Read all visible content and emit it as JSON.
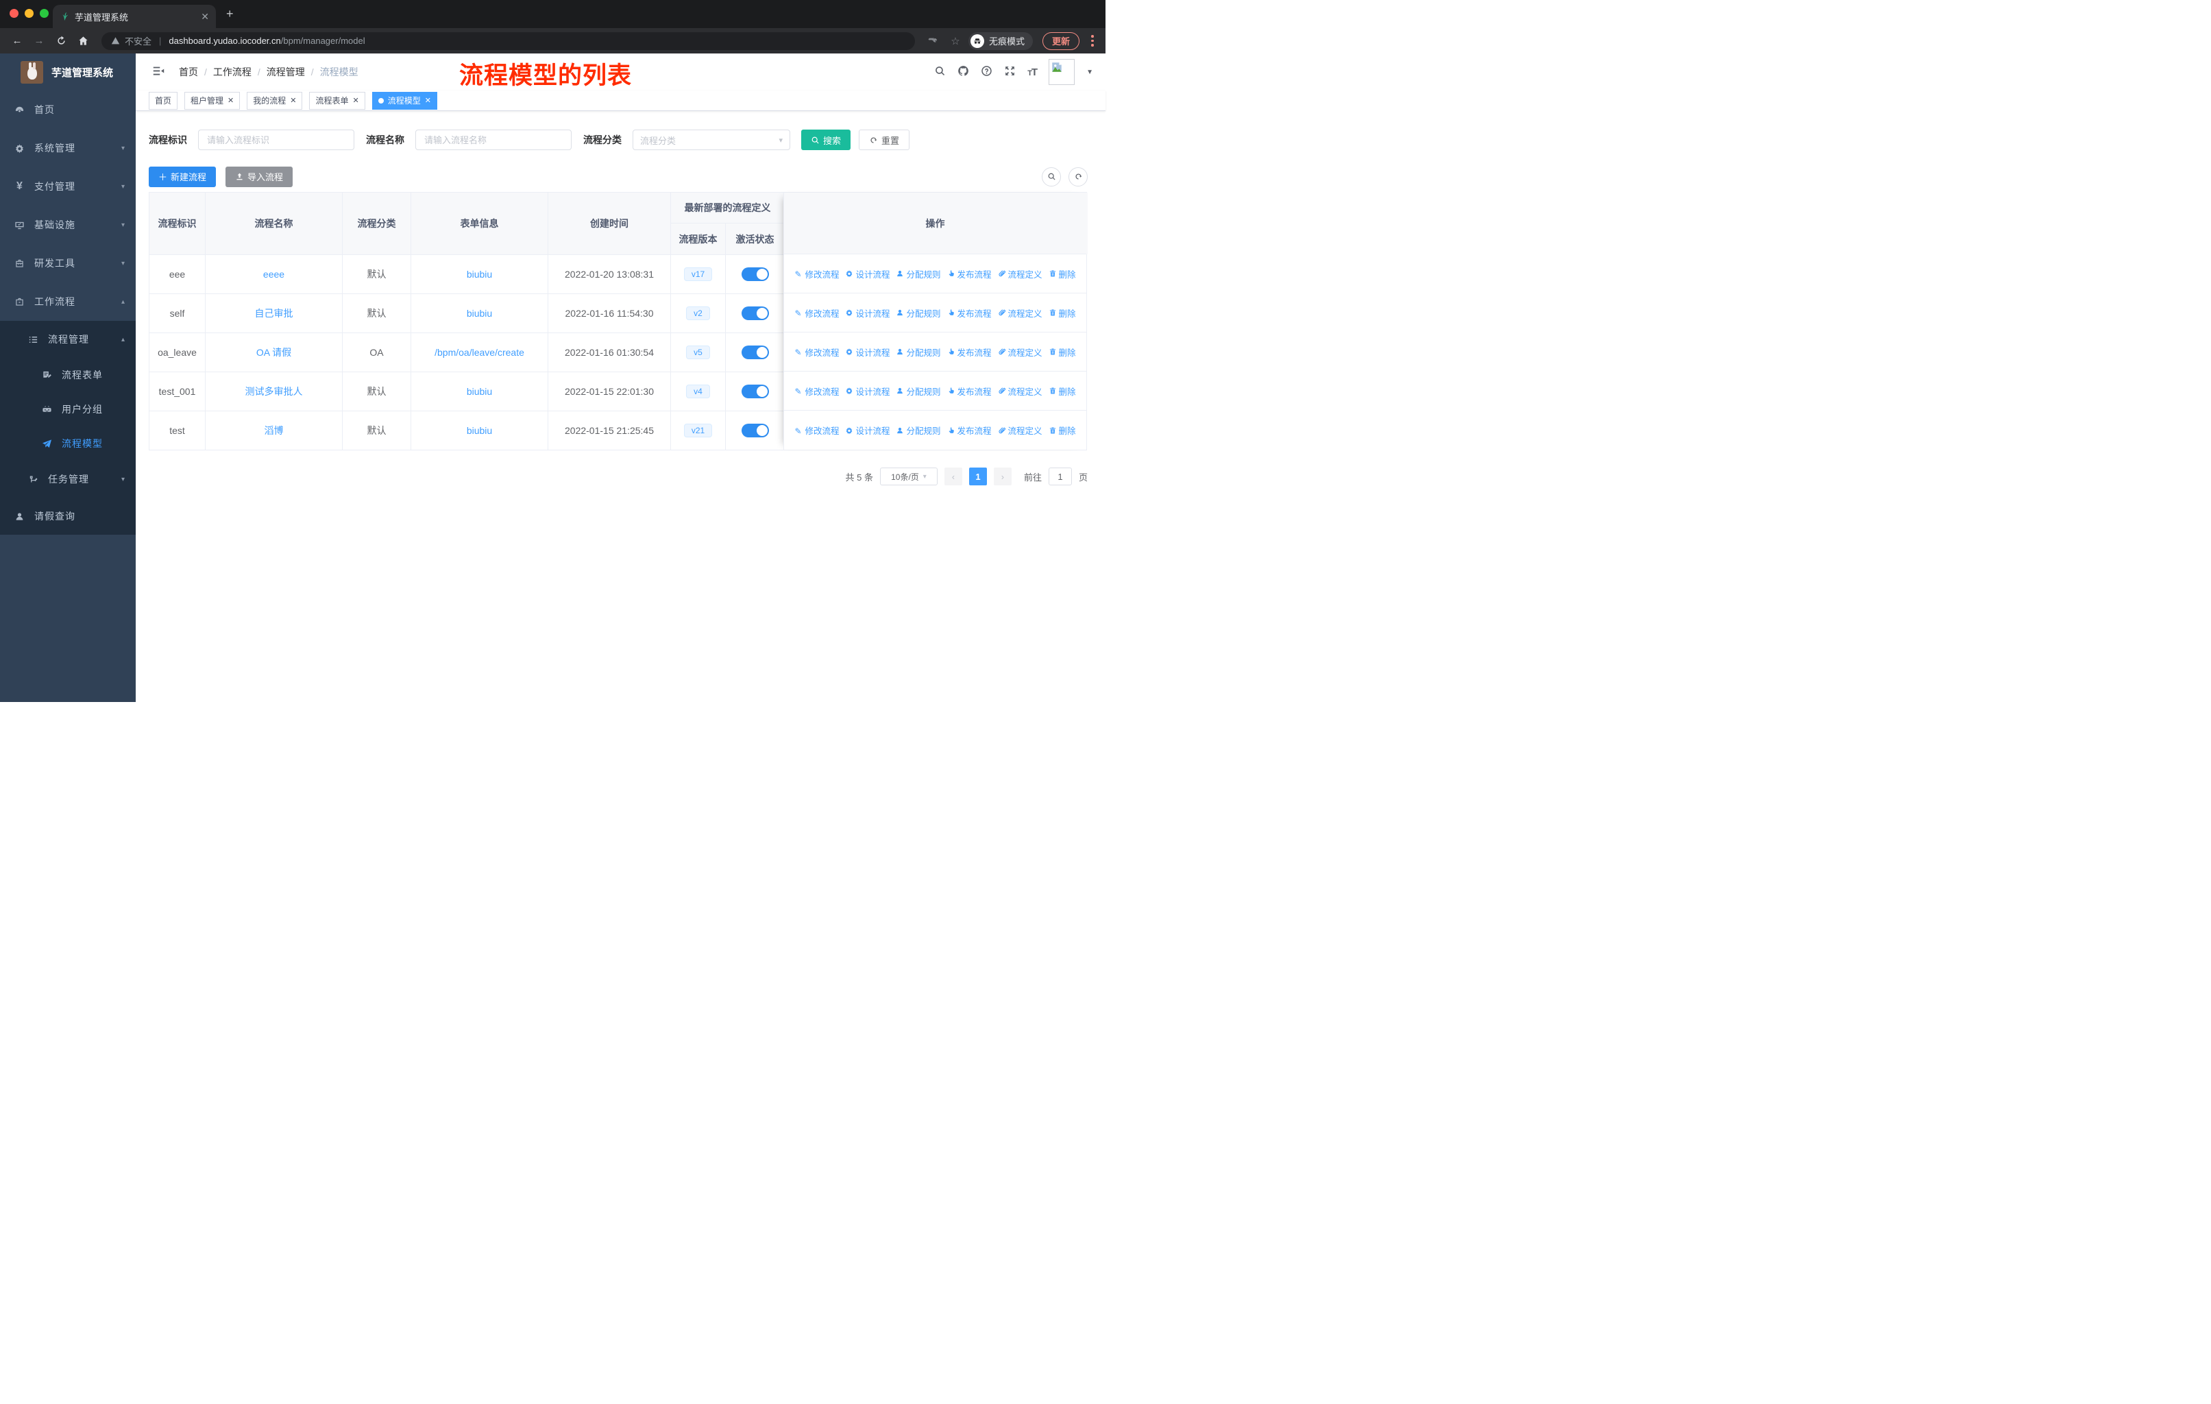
{
  "browser": {
    "tab_title": "芋道管理系统",
    "security_label": "不安全",
    "url_host": "dashboard.yudao.iocoder.cn",
    "url_path": "/bpm/manager/model",
    "incognito_label": "无痕模式",
    "update_label": "更新"
  },
  "sidebar": {
    "app_title": "芋道管理系统",
    "items": [
      {
        "label": "首页",
        "icon": "dashboard-icon"
      },
      {
        "label": "系统管理",
        "icon": "gear-icon",
        "arrow": "down"
      },
      {
        "label": "支付管理",
        "icon": "yen-icon",
        "arrow": "down"
      },
      {
        "label": "基础设施",
        "icon": "monitor-icon",
        "arrow": "down"
      },
      {
        "label": "研发工具",
        "icon": "toolbox-icon",
        "arrow": "down"
      },
      {
        "label": "工作流程",
        "icon": "briefcase-icon",
        "arrow": "up"
      },
      {
        "label": "流程管理",
        "icon": "list-tree-icon",
        "arrow": "up"
      },
      {
        "label": "流程表单",
        "icon": "form-edit-icon"
      },
      {
        "label": "用户分组",
        "icon": "robot-icon"
      },
      {
        "label": "流程模型",
        "icon": "paper-plane-icon",
        "active": true
      },
      {
        "label": "任务管理",
        "icon": "org-tree-icon",
        "arrow": "down"
      },
      {
        "label": "请假查询",
        "icon": "user-icon"
      }
    ]
  },
  "header": {
    "breadcrumb": [
      "首页",
      "工作流程",
      "流程管理",
      "流程模型"
    ],
    "annotation": "流程模型的列表"
  },
  "tags": [
    {
      "label": "首页",
      "closable": false,
      "active": false
    },
    {
      "label": "租户管理",
      "closable": true,
      "active": false
    },
    {
      "label": "我的流程",
      "closable": true,
      "active": false
    },
    {
      "label": "流程表单",
      "closable": true,
      "active": false
    },
    {
      "label": "流程模型",
      "closable": true,
      "active": true
    }
  ],
  "filter": {
    "fields": [
      {
        "label": "流程标识",
        "placeholder": "请输入流程标识"
      },
      {
        "label": "流程名称",
        "placeholder": "请输入流程名称"
      },
      {
        "label": "流程分类",
        "placeholder": "流程分类"
      }
    ],
    "search_label": "搜索",
    "reset_label": "重置"
  },
  "toolbar": {
    "create_label": "新建流程",
    "import_label": "导入流程"
  },
  "table": {
    "headers": {
      "id": "流程标识",
      "name": "流程名称",
      "category": "流程分类",
      "form": "表单信息",
      "created": "创建时间",
      "group": "最新部署的流程定义",
      "version": "流程版本",
      "status": "激活状态",
      "ops": "操作"
    },
    "rows": [
      {
        "id": "eee",
        "name": "eeee",
        "category": "默认",
        "form": "biubiu",
        "created": "2022-01-20 13:08:31",
        "version": "v17",
        "active": true
      },
      {
        "id": "self",
        "name": "自己审批",
        "category": "默认",
        "form": "biubiu",
        "created": "2022-01-16 11:54:30",
        "version": "v2",
        "active": true
      },
      {
        "id": "oa_leave",
        "name": "OA 请假",
        "category": "OA",
        "form": "/bpm/oa/leave/create",
        "created": "2022-01-16 01:30:54",
        "version": "v5",
        "active": true
      },
      {
        "id": "test_001",
        "name": "测试多审批人",
        "category": "默认",
        "form": "biubiu",
        "created": "2022-01-15 22:01:30",
        "version": "v4",
        "active": true
      },
      {
        "id": "test",
        "name": "滔博",
        "category": "默认",
        "form": "biubiu",
        "created": "2022-01-15 21:25:45",
        "version": "v21",
        "active": true
      }
    ],
    "actions": [
      "修改流程",
      "设计流程",
      "分配规则",
      "发布流程",
      "流程定义",
      "删除"
    ]
  },
  "pagination": {
    "total": "共 5 条",
    "size": "10条/页",
    "page": "1",
    "goto_label": "前往",
    "goto_value": "1",
    "page_unit": "页"
  },
  "colors": {
    "primary": "#409eff",
    "search_button": "#1abc9c",
    "toggle_on": "#2d8cf0",
    "annotation": "#ff2c00",
    "sidebar_bg": "#304156",
    "submenu_bg": "#1f2d3d",
    "update_chip": "#f28b82",
    "tag_active": "#409eff"
  }
}
